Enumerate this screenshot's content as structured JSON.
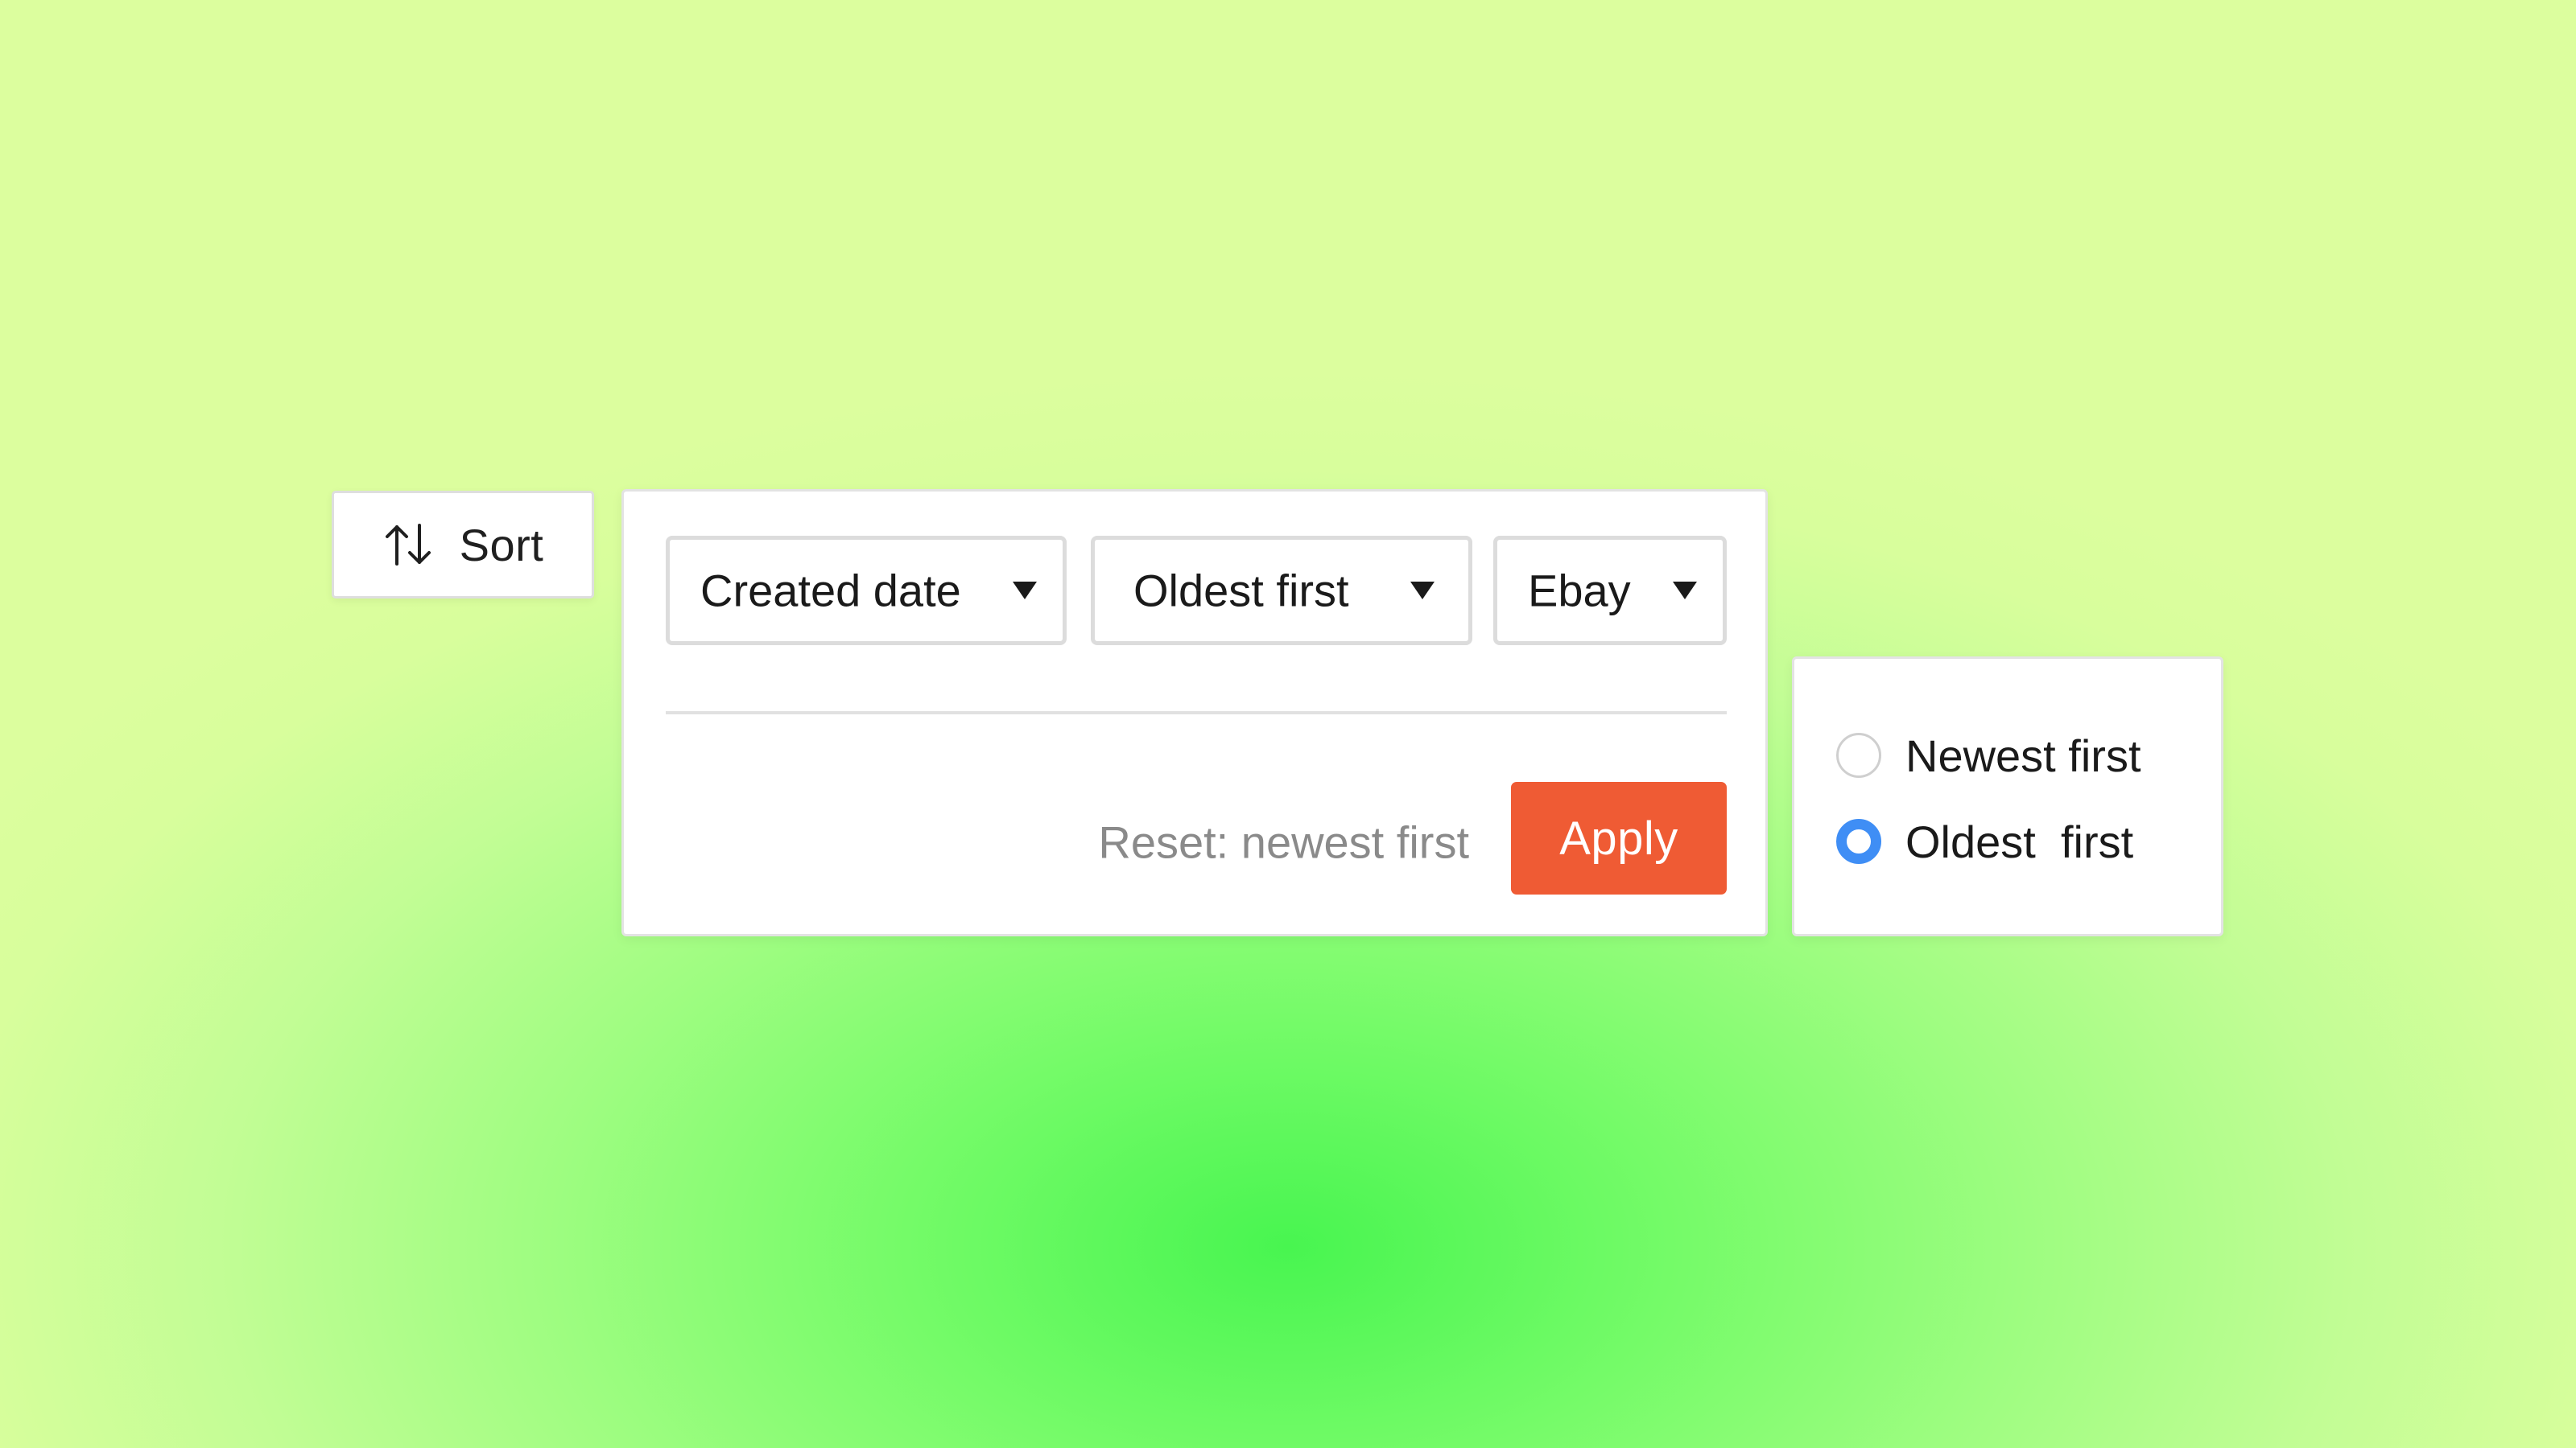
{
  "sort_button": {
    "icon": "sort-arrows-icon",
    "label": "Sort"
  },
  "sort_panel": {
    "field_select": {
      "value": "Created date",
      "icon": "caret-down-icon"
    },
    "order_select": {
      "value": "Oldest first",
      "icon": "caret-down-icon"
    },
    "source_select": {
      "value": "Ebay",
      "icon": "caret-down-icon"
    },
    "reset_label": "Reset: newest first",
    "apply_label": "Apply"
  },
  "order_options": [
    {
      "label": "Newest first",
      "selected": false
    },
    {
      "label": "Oldest  first",
      "selected": true
    }
  ],
  "colors": {
    "accent": "#ef5b34",
    "radio_selected": "#3f8ef5",
    "background_center": "#48f550",
    "background_edge": "#dcfe9e"
  }
}
